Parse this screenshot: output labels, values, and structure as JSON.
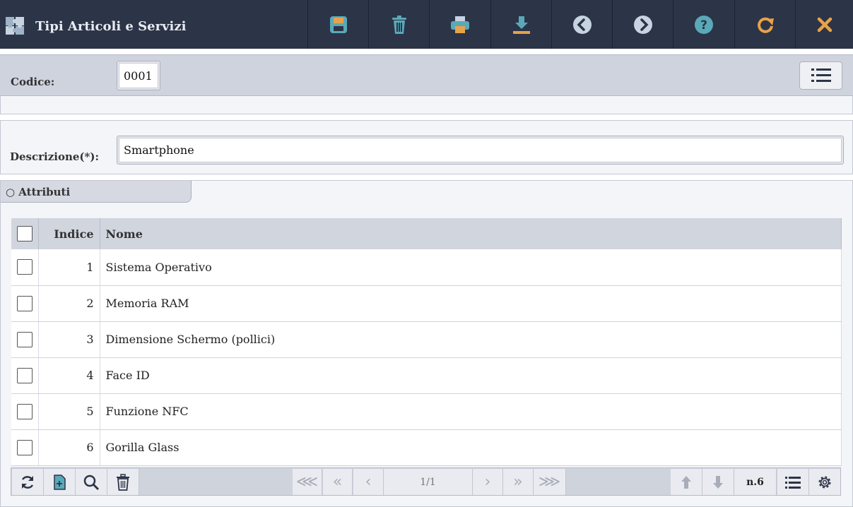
{
  "app": {
    "title": "Tipi Articoli e Servizi",
    "logo": "puzzle-icon"
  },
  "toolbar": [
    {
      "name": "save-button",
      "icon": "save-icon"
    },
    {
      "name": "delete-button",
      "icon": "trash-icon"
    },
    {
      "name": "print-button",
      "icon": "printer-icon"
    },
    {
      "name": "download-button",
      "icon": "download-icon"
    },
    {
      "name": "previous-button",
      "icon": "chevron-left-icon"
    },
    {
      "name": "next-button",
      "icon": "chevron-right-icon"
    },
    {
      "name": "help-button",
      "icon": "help-icon"
    },
    {
      "name": "refresh-button",
      "icon": "redo-icon"
    },
    {
      "name": "close-button",
      "icon": "close-icon"
    }
  ],
  "form": {
    "codice_label": "Codice:",
    "codice_value": "0001",
    "descrizione_label": "Descrizione(*):",
    "descrizione_value": "Smartphone"
  },
  "attributi": {
    "tab_label": "○ Attributi",
    "columns": {
      "indice": "Indice",
      "nome": "Nome"
    },
    "rows": [
      {
        "indice": "1",
        "nome": "Sistema Operativo"
      },
      {
        "indice": "2",
        "nome": "Memoria RAM"
      },
      {
        "indice": "3",
        "nome": "Dimensione Schermo (pollici)"
      },
      {
        "indice": "4",
        "nome": "Face ID"
      },
      {
        "indice": "5",
        "nome": "Funzione NFC"
      },
      {
        "indice": "6",
        "nome": "Gorilla Glass"
      }
    ]
  },
  "pager": {
    "first": "⋘",
    "prev_page": "«",
    "prev": "‹",
    "page": "1/1",
    "next": "›",
    "next_page": "»",
    "last": "⋙",
    "count": "n.6"
  },
  "colors": {
    "topbar": "#2c3447",
    "accent_teal": "#5aa9b8",
    "accent_orange": "#e8a24a"
  }
}
